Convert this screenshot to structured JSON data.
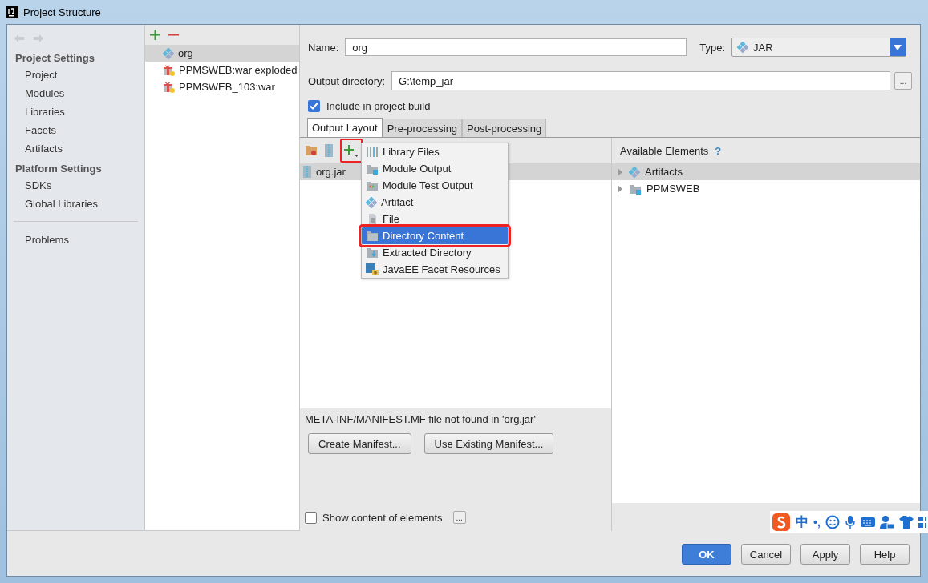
{
  "window": {
    "title": "Project Structure"
  },
  "sidebar": {
    "sections": [
      {
        "title": "Project Settings",
        "items": [
          {
            "label": "Project",
            "selected": false
          },
          {
            "label": "Modules",
            "selected": false
          },
          {
            "label": "Libraries",
            "selected": false
          },
          {
            "label": "Facets",
            "selected": false
          },
          {
            "label": "Artifacts",
            "selected": false
          }
        ]
      },
      {
        "title": "Platform Settings",
        "items": [
          {
            "label": "SDKs",
            "selected": false
          },
          {
            "label": "Global Libraries",
            "selected": false
          }
        ]
      }
    ],
    "footer_items": [
      {
        "label": "Problems",
        "selected": false
      }
    ]
  },
  "artifacts": [
    {
      "name": "org",
      "kind": "jar",
      "selected": true
    },
    {
      "name": "PPMSWEB:war exploded",
      "kind": "war",
      "selected": false
    },
    {
      "name": "PPMSWEB_103:war",
      "kind": "war",
      "selected": false
    }
  ],
  "form": {
    "name_label": "Name:",
    "name_value": "org",
    "type_label": "Type:",
    "type_value": "JAR",
    "output_label": "Output directory:",
    "output_value": "G:\\temp_jar",
    "browse_button": "...",
    "include_checkbox": {
      "label": "Include in project build",
      "checked": true
    }
  },
  "tabs": [
    {
      "label": "Output Layout",
      "selected": true
    },
    {
      "label": "Pre-processing",
      "selected": false
    },
    {
      "label": "Post-processing",
      "selected": false
    }
  ],
  "layout_toolbar": {
    "add_highlighted": true
  },
  "layout_tree": [
    {
      "name": "org.jar",
      "selected": true
    }
  ],
  "add_menu": [
    {
      "label": "Library Files",
      "kind": "library",
      "selected": false,
      "highlighted": false
    },
    {
      "label": "Module Output",
      "kind": "module",
      "selected": false,
      "highlighted": false
    },
    {
      "label": "Module Test Output",
      "kind": "test",
      "selected": false,
      "highlighted": false
    },
    {
      "label": "Artifact",
      "kind": "artifact",
      "selected": false,
      "highlighted": false
    },
    {
      "label": "File",
      "kind": "file",
      "selected": false,
      "highlighted": false
    },
    {
      "label": "Directory Content",
      "kind": "folder",
      "selected": true,
      "highlighted": true
    },
    {
      "label": "Extracted Directory",
      "kind": "extract",
      "selected": false,
      "highlighted": false
    },
    {
      "label": "JavaEE Facet Resources",
      "kind": "javaee",
      "selected": false,
      "highlighted": false
    }
  ],
  "manifest": {
    "message": "META-INF/MANIFEST.MF file not found in 'org.jar'",
    "buttons": [
      "Create Manifest...",
      "Use Existing Manifest..."
    ]
  },
  "show_content": {
    "label": "Show content of elements",
    "checked": false,
    "button": "..."
  },
  "available": {
    "title": "Available Elements",
    "help": "?",
    "items": [
      {
        "name": "Artifacts",
        "kind": "artifact",
        "selected": true,
        "expanded": false
      },
      {
        "name": "PPMSWEB",
        "kind": "module",
        "selected": false,
        "expanded": false
      }
    ]
  },
  "dialog_buttons": [
    {
      "label": "OK",
      "default": true
    },
    {
      "label": "Cancel",
      "default": false
    },
    {
      "label": "Apply",
      "default": false
    },
    {
      "label": "Help",
      "default": false
    }
  ],
  "ime_bar": {
    "mode": "中",
    "punct": "•,"
  }
}
